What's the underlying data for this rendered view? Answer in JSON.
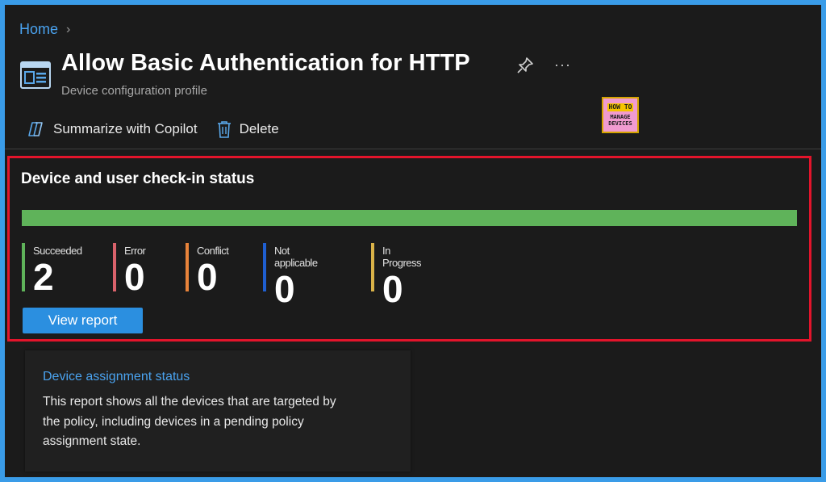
{
  "breadcrumb": {
    "home": "Home",
    "separator": "›"
  },
  "header": {
    "title": "Allow Basic Authentication for HTTP",
    "subtitle": "Device configuration profile",
    "more": "···",
    "icons": {
      "page": "device-profile-icon",
      "pin": "pin-icon",
      "more": "ellipsis-icon"
    }
  },
  "watermark": {
    "line1": "HOW TO",
    "line2": "MANAGE",
    "line3": "DEVICES"
  },
  "toolbar": {
    "summarize_label": "Summarize with Copilot",
    "delete_label": "Delete",
    "icons": {
      "summarize": "copilot-icon",
      "delete": "trash-icon"
    }
  },
  "status": {
    "title": "Device and user check-in status",
    "progress_succeeded_fraction": 1.0,
    "items": [
      {
        "label": "Succeeded",
        "value": "2",
        "color": "#5fb35a"
      },
      {
        "label": "Error",
        "value": "0",
        "color": "#d9626b"
      },
      {
        "label": "Conflict",
        "value": "0",
        "color": "#e8833a"
      },
      {
        "label": "Not applicable",
        "value": "0",
        "color": "#1f5fd1"
      },
      {
        "label": "In Progress",
        "value": "0",
        "color": "#d9b248"
      }
    ],
    "view_report_label": "View report"
  },
  "assignment_card": {
    "link": "Device assignment status",
    "description": "This report shows all the devices that are targeted by the policy, including devices in a pending policy assignment state."
  },
  "colors": {
    "background": "#1b1b1b",
    "frame": "#3a9ce8",
    "accent": "#2b8fe0",
    "link": "#4aa3f0",
    "highlight_border": "#e3142b"
  }
}
